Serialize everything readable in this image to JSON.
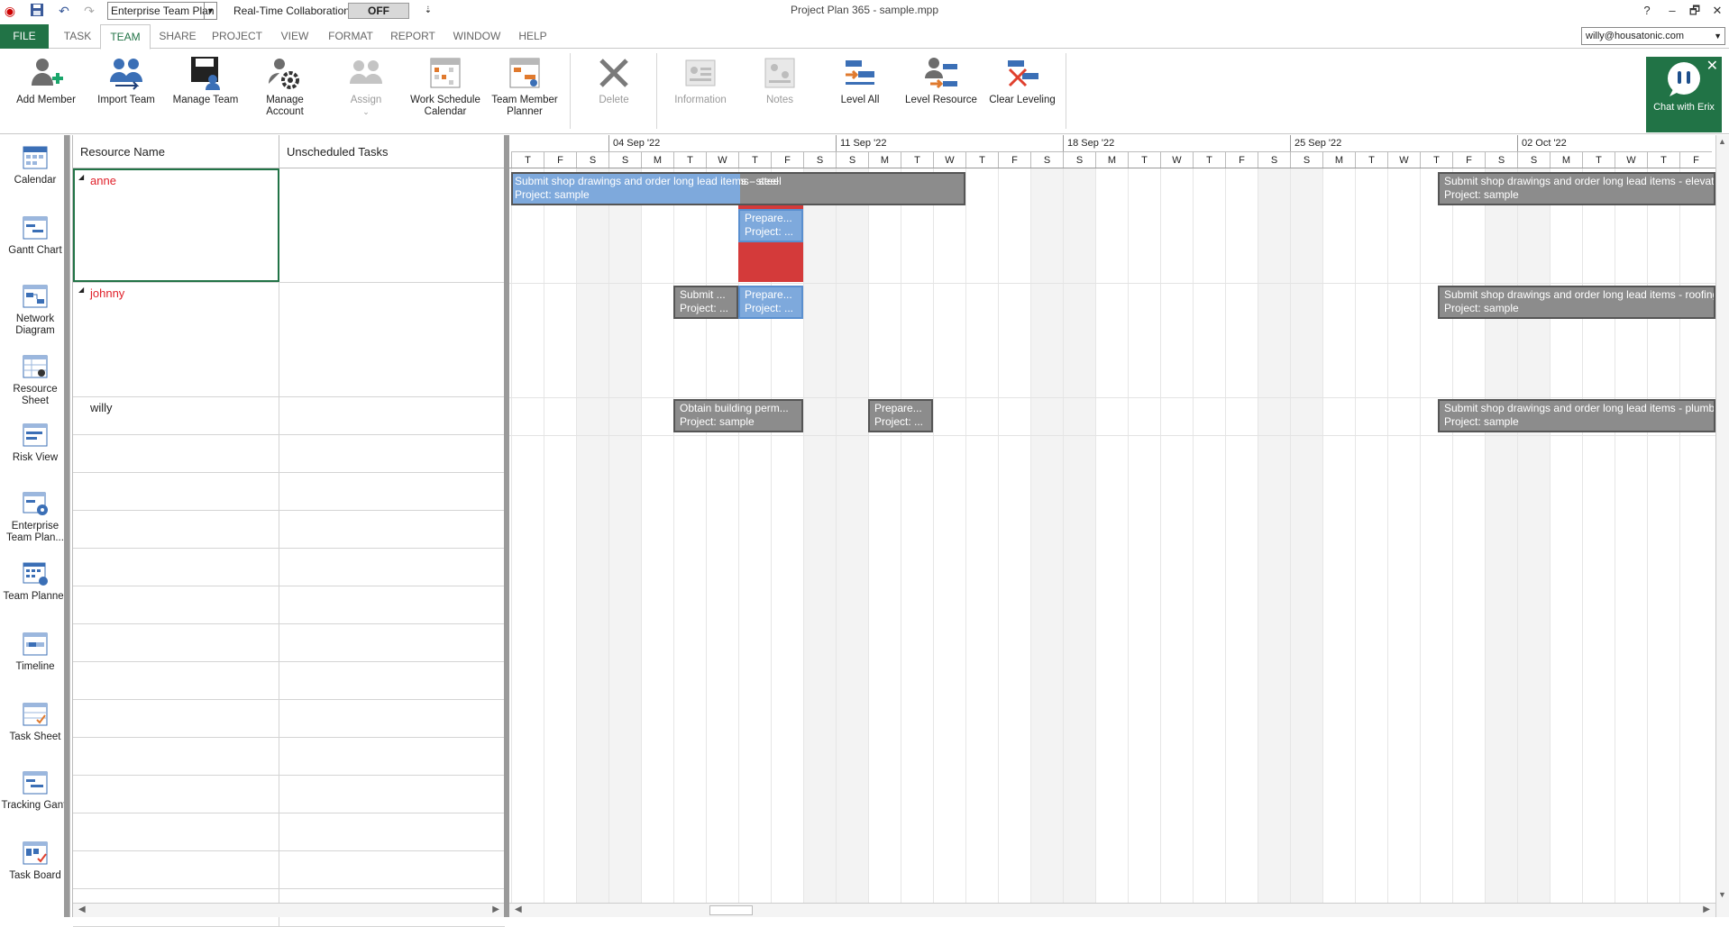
{
  "titlebar": {
    "view_select": "Enterprise Team Plan",
    "rtc_label": "Real-Time Collaboration",
    "rtc_toggle": "OFF",
    "title": "Project Plan 365 - sample.mpp",
    "help": "?",
    "minimize": "–",
    "restore": "🗗",
    "close": "✕"
  },
  "menu": {
    "file": "FILE",
    "tabs": [
      "TASK",
      "TEAM",
      "SHARE",
      "PROJECT",
      "VIEW",
      "FORMAT",
      "REPORT",
      "WINDOW",
      "HELP"
    ],
    "active_tab": "TEAM",
    "account": "willy@housatonic.com"
  },
  "ribbon": {
    "add_member": "Add Member",
    "import_team": "Import Team",
    "manage_team": "Manage Team",
    "manage_account": "Manage Account",
    "assign": "Assign",
    "work_schedule_calendar": "Work Schedule Calendar",
    "team_member_planner": "Team Member Planner",
    "delete": "Delete",
    "information": "Information",
    "notes": "Notes",
    "level_all": "Level All",
    "level_resource": "Level Resource",
    "clear_leveling": "Clear Leveling",
    "chat": "Chat with Erix"
  },
  "views": {
    "calendar": "Calendar",
    "gantt_chart": "Gantt Chart",
    "network_diagram": "Network Diagram",
    "resource_sheet": "Resource Sheet",
    "risk_view": "Risk View",
    "enterprise_team_plan": "Enterprise Team Plan...",
    "team_planner": "Team Planner",
    "timeline": "Timeline",
    "task_sheet": "Task Sheet",
    "tracking_gantt": "Tracking Gantt",
    "task_board": "Task Board"
  },
  "grid": {
    "col_resource": "Resource Name",
    "col_unscheduled": "Unscheduled Tasks",
    "resources": [
      "anne",
      "johnny",
      "willy"
    ]
  },
  "timescale": {
    "weeks": [
      "04 Sep '22",
      "11 Sep '22",
      "18 Sep '22",
      "25 Sep '22",
      "02 Oct '22"
    ],
    "days": [
      "T",
      "F",
      "S",
      "S",
      "M",
      "T",
      "W",
      "T",
      "F",
      "S",
      "S",
      "M",
      "T",
      "W",
      "T",
      "F",
      "S",
      "S",
      "M",
      "T",
      "W",
      "T",
      "F",
      "S",
      "S",
      "M",
      "T",
      "W",
      "T",
      "F",
      "S",
      "S",
      "M",
      "T",
      "W",
      "T",
      "F"
    ]
  },
  "tasks": {
    "anne_steel": {
      "line1": "Submit shop drawings and order long lead items - steel",
      "line2": "Project: sample"
    },
    "anne_prepare": {
      "line1": "Prepare...",
      "line2": "Project: ..."
    },
    "anne_elevator": {
      "line1": "Submit shop drawings and order long lead items - elevator",
      "line2": "Project: sample"
    },
    "johnny_submit": {
      "line1": "Submit ...",
      "line2": "Project: ..."
    },
    "johnny_prepare": {
      "line1": "Prepare...",
      "line2": "Project: ..."
    },
    "johnny_roofing": {
      "line1": "Submit shop drawings and order long lead items - roofing",
      "line2": "Project: sample"
    },
    "willy_permit": {
      "line1": "Obtain building perm...",
      "line2": "Project: sample"
    },
    "willy_prepare": {
      "line1": "Prepare...",
      "line2": "Project: ..."
    },
    "willy_plumbing": {
      "line1": "Submit shop drawings and order long lead items - plumbing",
      "line2": "Project: sample"
    }
  }
}
